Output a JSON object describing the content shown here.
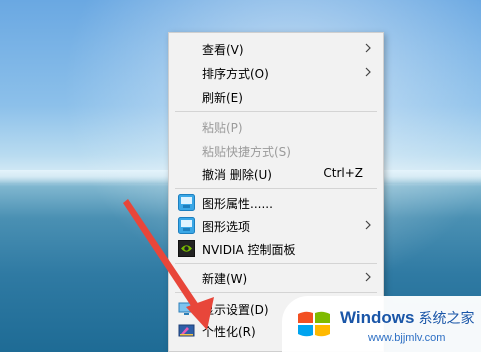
{
  "context_menu": {
    "items": [
      {
        "label": "查看(V)",
        "submenu": true
      },
      {
        "label": "排序方式(O)",
        "submenu": true
      },
      {
        "label": "刷新(E)"
      },
      {
        "label": "粘贴(P)",
        "disabled": true
      },
      {
        "label": "粘贴快捷方式(S)",
        "disabled": true
      },
      {
        "label": "撤消 删除(U)",
        "shortcut": "Ctrl+Z"
      },
      {
        "label": "图形属性......",
        "icon": "graphics-properties-icon"
      },
      {
        "label": "图形选项",
        "icon": "graphics-options-icon",
        "submenu": true
      },
      {
        "label": "NVIDIA 控制面板",
        "icon": "nvidia-icon"
      },
      {
        "label": "新建(W)",
        "submenu": true
      },
      {
        "label": "显示设置(D)",
        "icon": "display-settings-icon"
      },
      {
        "label": "个性化(R)",
        "icon": "personalize-icon"
      }
    ]
  },
  "watermark": {
    "brand": "Windows",
    "brand_cn": "系统之家",
    "url": "www.bjjmlv.com"
  },
  "colors": {
    "menu_bg": "#f2f2f2",
    "disabled_text": "#9b9b9b",
    "arrow_red": "#e8463a",
    "watermark_blue": "#1a56a8"
  }
}
